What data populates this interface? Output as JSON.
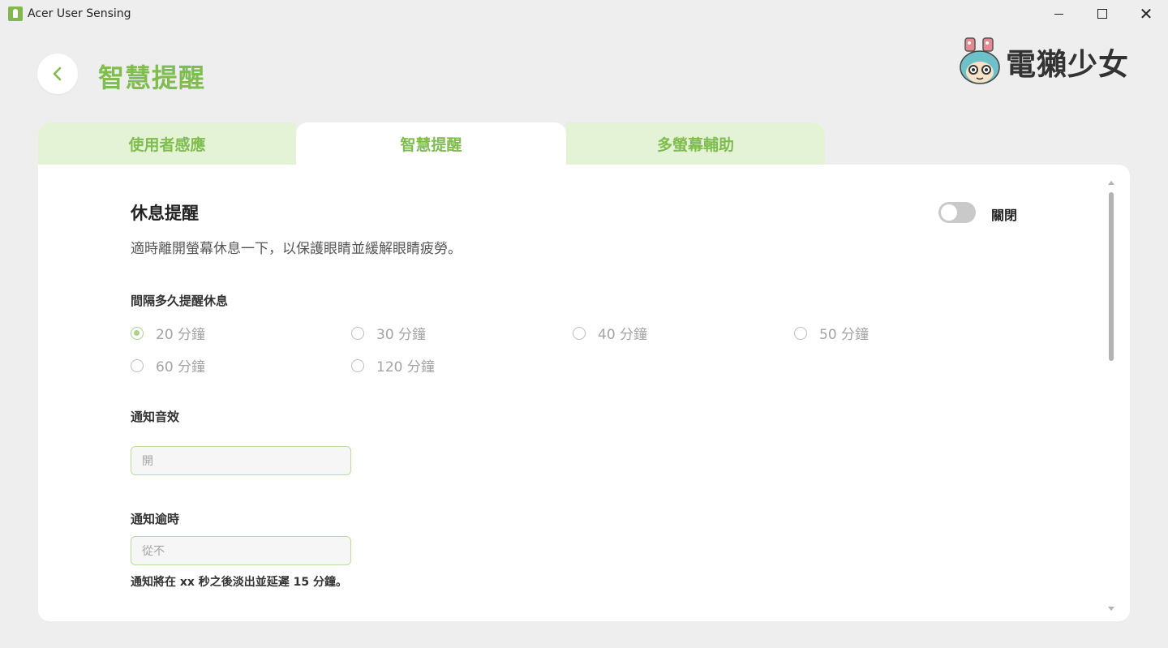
{
  "window": {
    "title": "Acer User Sensing",
    "minimize_label": "",
    "close_glyph": "✕"
  },
  "header": {
    "title": "智慧提醒",
    "brand_text": "電獺少女"
  },
  "tabs": [
    {
      "label": "使用者感應",
      "active": false
    },
    {
      "label": "智慧提醒",
      "active": true
    },
    {
      "label": "多螢幕輔助",
      "active": false
    }
  ],
  "break_reminder": {
    "title": "休息提醒",
    "description": "適時離開螢幕休息一下，以保護眼睛並緩解眼睛疲勞。",
    "toggle_state_label": "關閉",
    "toggle_on": false
  },
  "interval": {
    "label": "間隔多久提醒休息",
    "options": [
      {
        "label": "20 分鐘",
        "checked": true
      },
      {
        "label": "30 分鐘",
        "checked": false
      },
      {
        "label": "40 分鐘",
        "checked": false
      },
      {
        "label": "50 分鐘",
        "checked": false
      },
      {
        "label": "60 分鐘",
        "checked": false
      },
      {
        "label": "120 分鐘",
        "checked": false
      }
    ]
  },
  "notification_sound": {
    "label": "通知音效",
    "value": "開"
  },
  "notification_timeout": {
    "label": "通知逾時",
    "value": "從不",
    "note": "通知將在 xx 秒之後淡出並延遲 15 分鐘。"
  },
  "colors": {
    "accent": "#7fbd4e",
    "tab_inactive_bg": "#e4f2d6",
    "radio_checked": "#a9d488"
  }
}
